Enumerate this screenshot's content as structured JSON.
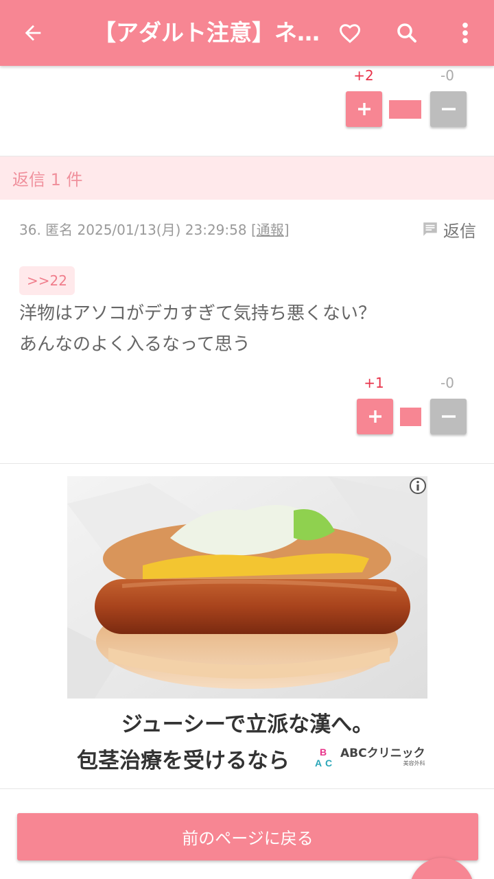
{
  "appbar": {
    "title": "【アダルト注意】ネ…",
    "icons": [
      "back-arrow-icon",
      "heart-icon",
      "search-icon",
      "more-vert-icon"
    ]
  },
  "prev_comment_votes": {
    "plus_count": "+2",
    "minus_count": "-0",
    "plus_label": "+",
    "minus_label": "−"
  },
  "reply_section": {
    "label": "返信 1 件"
  },
  "comment": {
    "meta_prefix": "36. 匿名 2025/01/13(月) 23:29:58 [",
    "report_label": "通報",
    "meta_suffix": "]",
    "reply_label": "返信",
    "anchor": ">>22",
    "lines": [
      "洋物はアソコがデカすぎて気持ち悪くない？",
      "あんなのよく入るなって思う"
    ],
    "votes": {
      "plus_count": "+1",
      "minus_count": "-0",
      "plus_label": "+",
      "minus_label": "−"
    }
  },
  "ad": {
    "caption_line1": "ジューシーで立派な漢へ。",
    "caption_line2": "包茎治療を受けるなら",
    "brand_name": "ABCクリニック",
    "brand_sub": "美容外科",
    "info_icon": "info-icon"
  },
  "footer": {
    "back_button": "前のページに戻る"
  },
  "colors": {
    "accent": "#f78693",
    "plus_count": "#e8334a",
    "reply_band": "#ffe9eb",
    "minus_button": "#bdbdbd"
  }
}
